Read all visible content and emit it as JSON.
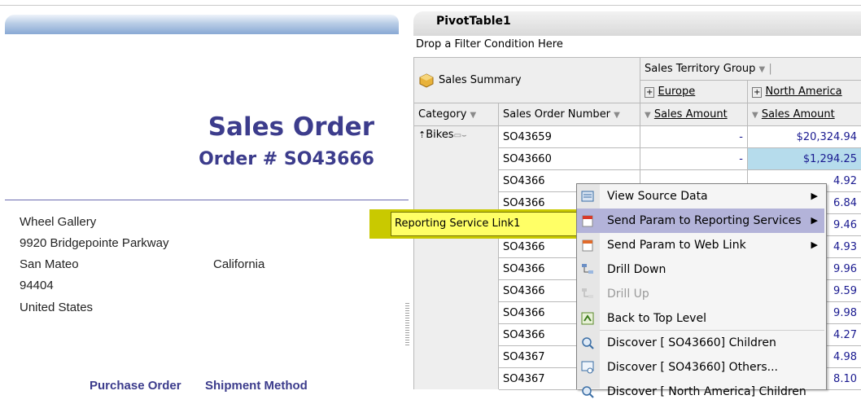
{
  "report": {
    "title": "Sales Order",
    "order_number": "Order # SO43666",
    "address": {
      "name": "Wheel Gallery",
      "street": "9920 Bridgepointe Parkway",
      "city": "San Mateo",
      "state": "California",
      "zip": "94404",
      "country": "United States"
    },
    "footer_labels": [
      "Purchase Order",
      "Shipment Method"
    ]
  },
  "pivot": {
    "title": "PivotTable1",
    "filter_hint": "Drop a Filter Condition Here",
    "cube_label": "Sales Summary",
    "col_dim": "Sales Territory Group",
    "col_members": [
      "Europe",
      "North America"
    ],
    "row_headers": [
      "Category",
      "Sales Order Number"
    ],
    "measure_headers": [
      "Sales Amount",
      "Sales Amount"
    ],
    "category": "Bikes",
    "rows": [
      {
        "order": "SO43659",
        "europe": "-",
        "na": "$20,324.94"
      },
      {
        "order": "SO43660",
        "europe": "-",
        "na": "$1,294.25"
      },
      {
        "order": "SO4366",
        "europe": "",
        "na": "4.92"
      },
      {
        "order": "SO4366",
        "europe": "",
        "na": "6.84"
      },
      {
        "order": "SO4366",
        "europe": "",
        "na": "9.46"
      },
      {
        "order": "SO4366",
        "europe": "",
        "na": "4.93"
      },
      {
        "order": "SO4366",
        "europe": "",
        "na": "9.96"
      },
      {
        "order": "SO4366",
        "europe": "",
        "na": "9.59"
      },
      {
        "order": "SO4366",
        "europe": "",
        "na": "9.98"
      },
      {
        "order": "SO4366",
        "europe": "",
        "na": "4.27"
      },
      {
        "order": "SO4367",
        "europe": "",
        "na": "4.98"
      },
      {
        "order": "SO4367",
        "europe": "",
        "na": "8.10"
      }
    ]
  },
  "callout": "Reporting Service Link1",
  "context_menu": {
    "items": [
      {
        "label": "View Source Data",
        "icon": "view-source-icon",
        "submenu": true
      },
      {
        "label": "Send Param to Reporting Services",
        "icon": "reporting-services-icon",
        "submenu": true,
        "highlighted": true
      },
      {
        "label": "Send Param to Web Link",
        "icon": "web-link-icon",
        "submenu": true
      },
      {
        "label": "Drill Down",
        "icon": "drill-down-icon"
      },
      {
        "label": "Drill Up",
        "icon": "drill-up-icon",
        "disabled": true
      },
      {
        "label": "Back to Top Level",
        "icon": "back-to-top-icon"
      },
      {
        "label": "Discover [ SO43660] Children",
        "icon": "discover-icon"
      },
      {
        "label": "Discover [ SO43660] Others...",
        "icon": "discover-others-icon"
      },
      {
        "label": "Discover [ North America] Children",
        "icon": "discover-icon"
      }
    ]
  },
  "colors": {
    "title_color": "#3c3c8c",
    "menu_highlight": "#b3b3d9",
    "callout_bg": "#ffff66"
  }
}
